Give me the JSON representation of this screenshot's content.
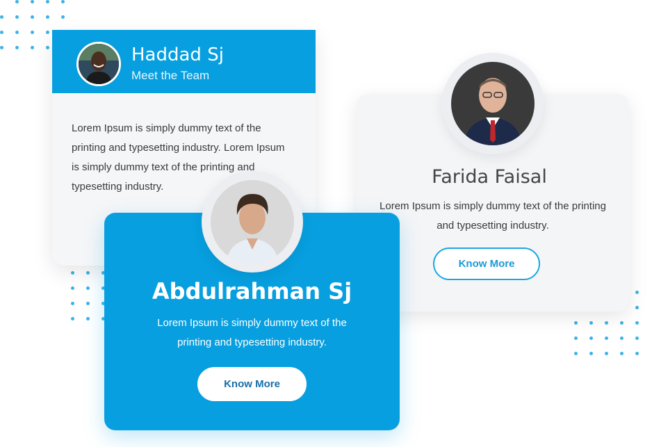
{
  "cards": [
    {
      "name": "Haddad Sj",
      "subtitle": "Meet the Team",
      "text": "Lorem Ipsum is simply dummy text of the printing and typesetting industry. Lorem Ipsum is simply dummy text of the printing and typesetting industry.",
      "avatar_icon": "person-portrait-icon"
    },
    {
      "name": "Abdulrahman Sj",
      "text": "Lorem Ipsum is simply dummy text of the printing and typesetting industry.",
      "button_label": "Know More",
      "avatar_icon": "person-portrait-icon"
    },
    {
      "name": "Farida Faisal",
      "text": "Lorem Ipsum is simply dummy text of the printing and typesetting industry.",
      "button_label": "Know More",
      "avatar_icon": "person-portrait-icon"
    }
  ],
  "colors": {
    "primary": "#079fe0",
    "card_bg": "#f4f5f7",
    "dots": "#3cb3e6"
  }
}
